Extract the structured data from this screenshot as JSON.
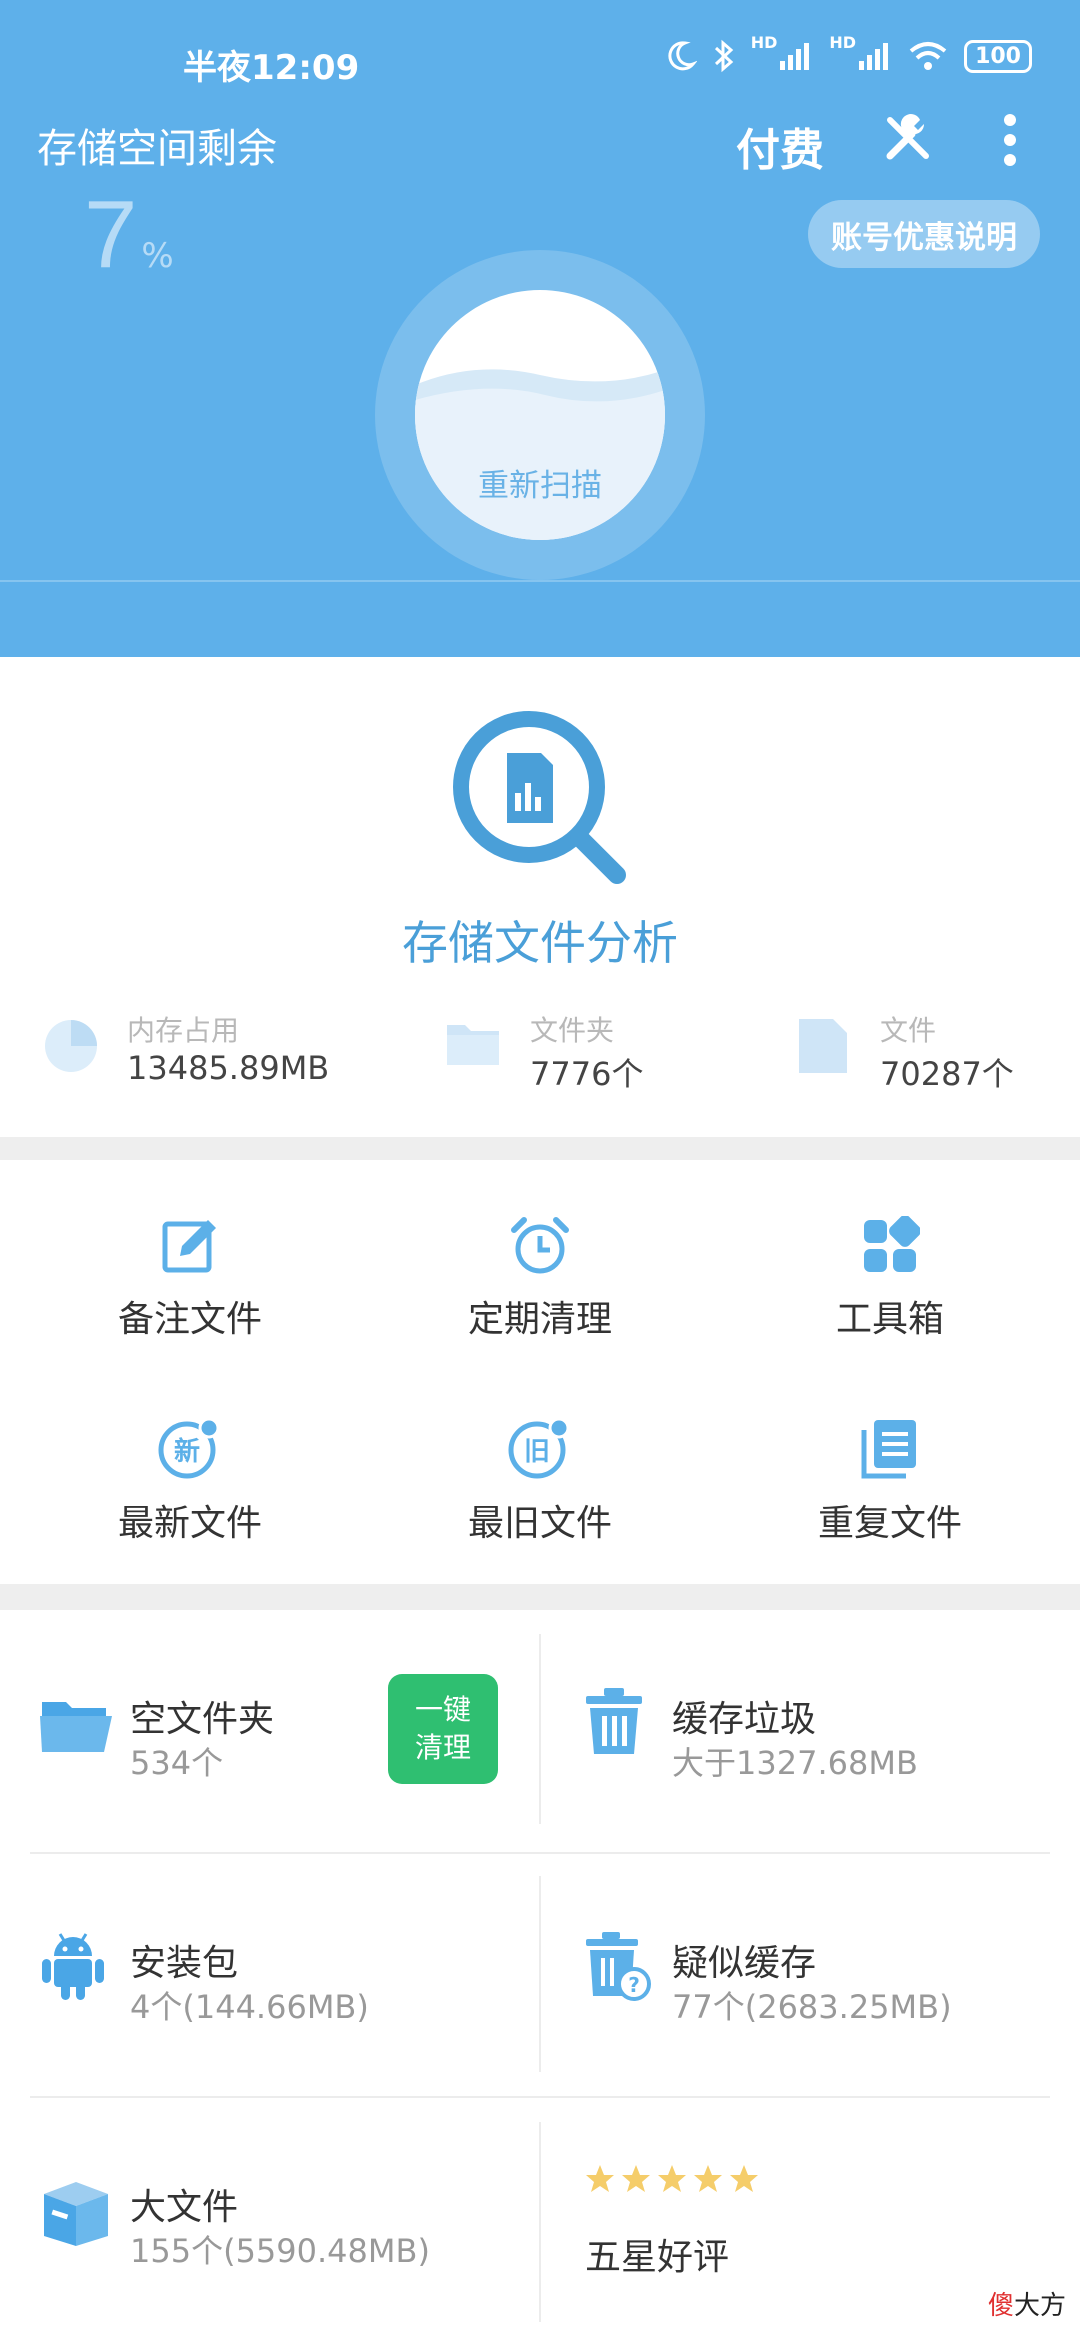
{
  "status_bar": {
    "time": "半夜12:09",
    "battery": "100",
    "signal_hd": "HD"
  },
  "header": {
    "title": "存储空间剩余",
    "pay_label": "付费",
    "percent_value": "7",
    "percent_unit": "%",
    "promo_label": "账号优惠说明",
    "scan_label": "重新扫描"
  },
  "analysis": {
    "title": "存储文件分析",
    "stats": [
      {
        "label": "内存占用",
        "value": "13485.89MB",
        "icon": "pie-chart-icon"
      },
      {
        "label": "文件夹",
        "value": "7776个",
        "icon": "folder-icon"
      },
      {
        "label": "文件",
        "value": "70287个",
        "icon": "file-icon"
      }
    ]
  },
  "features": [
    {
      "label": "备注文件",
      "icon": "edit-note-icon"
    },
    {
      "label": "定期清理",
      "icon": "alarm-clock-icon"
    },
    {
      "label": "工具箱",
      "icon": "toolbox-grid-icon"
    },
    {
      "label": "最新文件",
      "icon": "newest-file-icon",
      "badge": "新"
    },
    {
      "label": "最旧文件",
      "icon": "oldest-file-icon",
      "badge": "旧"
    },
    {
      "label": "重复文件",
      "icon": "duplicate-file-icon"
    }
  ],
  "tiles": {
    "empty_folder": {
      "title": "空文件夹",
      "sub": "534个",
      "button_line1": "一键",
      "button_line2": "清理"
    },
    "cache_junk": {
      "title": "缓存垃圾",
      "sub": "大于1327.68MB"
    },
    "apk": {
      "title": "安装包",
      "sub": "4个(144.66MB)"
    },
    "suspect_cache": {
      "title": "疑似缓存",
      "sub": "77个(2683.25MB)"
    },
    "big_files": {
      "title": "大文件",
      "sub": "155个(5590.48MB)"
    },
    "rating": {
      "title": "五星好评",
      "stars": 5
    }
  },
  "watermark": {
    "part1": "傻",
    "part2": "大方"
  },
  "colors": {
    "header_bg": "#5eb0ea",
    "accent": "#4a9fd8",
    "green": "#2fbf71",
    "star": "#f5cd6a"
  }
}
